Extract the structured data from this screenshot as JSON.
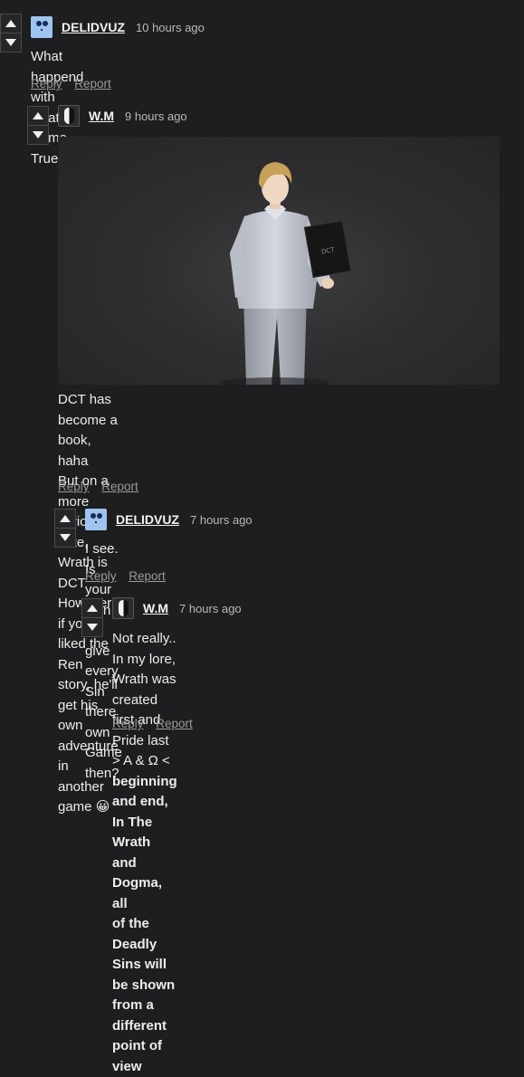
{
  "comments": [
    {
      "username": "DELIDVUZ",
      "time": "10 hours ago",
      "lines": [
        "What happend with Death Come True?"
      ],
      "reply_label": "Reply",
      "report_label": "Report"
    },
    {
      "username": "W.M",
      "time": "9 hours ago",
      "image_caption": "DCT",
      "lines": [
        "DCT has become a book, haha",
        "But on a more serious note, Wrath is DCT",
        "However if you liked the Ren story, he'll get his own adventure in",
        "another game 😀"
      ],
      "reply_label": "Reply",
      "report_label": "Report"
    },
    {
      "username": "DELIDVUZ",
      "time": "7 hours ago",
      "lines": [
        "I see. Is your plan to give every Sin there own Game then?"
      ],
      "reply_label": "Reply",
      "report_label": "Report"
    },
    {
      "username": "W.M",
      "time": "7 hours ago",
      "line1": "Not really.. In my lore, Wrath was created first and Pride last",
      "line2_plain": "> A & Ω < ",
      "line2_bold": "beginning and end,  In The Wrath and Dogma, all",
      "line3_bold": "of the Deadly Sins will be shown from a different point of",
      "line4_bold": "view",
      "reply_label": "Reply",
      "report_label": "Report"
    }
  ]
}
